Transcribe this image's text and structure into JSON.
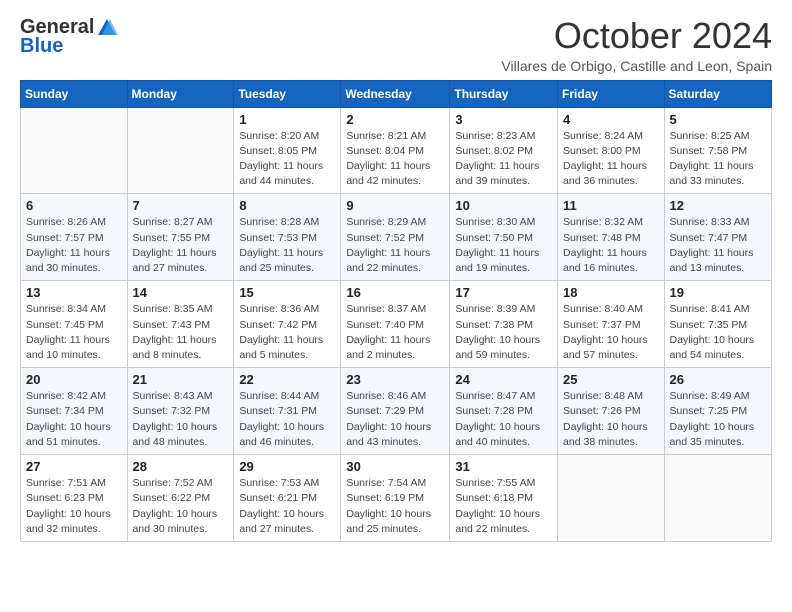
{
  "header": {
    "logo_general": "General",
    "logo_blue": "Blue",
    "month_title": "October 2024",
    "subtitle": "Villares de Orbigo, Castille and Leon, Spain"
  },
  "weekdays": [
    "Sunday",
    "Monday",
    "Tuesday",
    "Wednesday",
    "Thursday",
    "Friday",
    "Saturday"
  ],
  "weeks": [
    [
      {
        "day": "",
        "info": ""
      },
      {
        "day": "",
        "info": ""
      },
      {
        "day": "1",
        "info": "Sunrise: 8:20 AM\nSunset: 8:05 PM\nDaylight: 11 hours and 44 minutes."
      },
      {
        "day": "2",
        "info": "Sunrise: 8:21 AM\nSunset: 8:04 PM\nDaylight: 11 hours and 42 minutes."
      },
      {
        "day": "3",
        "info": "Sunrise: 8:23 AM\nSunset: 8:02 PM\nDaylight: 11 hours and 39 minutes."
      },
      {
        "day": "4",
        "info": "Sunrise: 8:24 AM\nSunset: 8:00 PM\nDaylight: 11 hours and 36 minutes."
      },
      {
        "day": "5",
        "info": "Sunrise: 8:25 AM\nSunset: 7:58 PM\nDaylight: 11 hours and 33 minutes."
      }
    ],
    [
      {
        "day": "6",
        "info": "Sunrise: 8:26 AM\nSunset: 7:57 PM\nDaylight: 11 hours and 30 minutes."
      },
      {
        "day": "7",
        "info": "Sunrise: 8:27 AM\nSunset: 7:55 PM\nDaylight: 11 hours and 27 minutes."
      },
      {
        "day": "8",
        "info": "Sunrise: 8:28 AM\nSunset: 7:53 PM\nDaylight: 11 hours and 25 minutes."
      },
      {
        "day": "9",
        "info": "Sunrise: 8:29 AM\nSunset: 7:52 PM\nDaylight: 11 hours and 22 minutes."
      },
      {
        "day": "10",
        "info": "Sunrise: 8:30 AM\nSunset: 7:50 PM\nDaylight: 11 hours and 19 minutes."
      },
      {
        "day": "11",
        "info": "Sunrise: 8:32 AM\nSunset: 7:48 PM\nDaylight: 11 hours and 16 minutes."
      },
      {
        "day": "12",
        "info": "Sunrise: 8:33 AM\nSunset: 7:47 PM\nDaylight: 11 hours and 13 minutes."
      }
    ],
    [
      {
        "day": "13",
        "info": "Sunrise: 8:34 AM\nSunset: 7:45 PM\nDaylight: 11 hours and 10 minutes."
      },
      {
        "day": "14",
        "info": "Sunrise: 8:35 AM\nSunset: 7:43 PM\nDaylight: 11 hours and 8 minutes."
      },
      {
        "day": "15",
        "info": "Sunrise: 8:36 AM\nSunset: 7:42 PM\nDaylight: 11 hours and 5 minutes."
      },
      {
        "day": "16",
        "info": "Sunrise: 8:37 AM\nSunset: 7:40 PM\nDaylight: 11 hours and 2 minutes."
      },
      {
        "day": "17",
        "info": "Sunrise: 8:39 AM\nSunset: 7:38 PM\nDaylight: 10 hours and 59 minutes."
      },
      {
        "day": "18",
        "info": "Sunrise: 8:40 AM\nSunset: 7:37 PM\nDaylight: 10 hours and 57 minutes."
      },
      {
        "day": "19",
        "info": "Sunrise: 8:41 AM\nSunset: 7:35 PM\nDaylight: 10 hours and 54 minutes."
      }
    ],
    [
      {
        "day": "20",
        "info": "Sunrise: 8:42 AM\nSunset: 7:34 PM\nDaylight: 10 hours and 51 minutes."
      },
      {
        "day": "21",
        "info": "Sunrise: 8:43 AM\nSunset: 7:32 PM\nDaylight: 10 hours and 48 minutes."
      },
      {
        "day": "22",
        "info": "Sunrise: 8:44 AM\nSunset: 7:31 PM\nDaylight: 10 hours and 46 minutes."
      },
      {
        "day": "23",
        "info": "Sunrise: 8:46 AM\nSunset: 7:29 PM\nDaylight: 10 hours and 43 minutes."
      },
      {
        "day": "24",
        "info": "Sunrise: 8:47 AM\nSunset: 7:28 PM\nDaylight: 10 hours and 40 minutes."
      },
      {
        "day": "25",
        "info": "Sunrise: 8:48 AM\nSunset: 7:26 PM\nDaylight: 10 hours and 38 minutes."
      },
      {
        "day": "26",
        "info": "Sunrise: 8:49 AM\nSunset: 7:25 PM\nDaylight: 10 hours and 35 minutes."
      }
    ],
    [
      {
        "day": "27",
        "info": "Sunrise: 7:51 AM\nSunset: 6:23 PM\nDaylight: 10 hours and 32 minutes."
      },
      {
        "day": "28",
        "info": "Sunrise: 7:52 AM\nSunset: 6:22 PM\nDaylight: 10 hours and 30 minutes."
      },
      {
        "day": "29",
        "info": "Sunrise: 7:53 AM\nSunset: 6:21 PM\nDaylight: 10 hours and 27 minutes."
      },
      {
        "day": "30",
        "info": "Sunrise: 7:54 AM\nSunset: 6:19 PM\nDaylight: 10 hours and 25 minutes."
      },
      {
        "day": "31",
        "info": "Sunrise: 7:55 AM\nSunset: 6:18 PM\nDaylight: 10 hours and 22 minutes."
      },
      {
        "day": "",
        "info": ""
      },
      {
        "day": "",
        "info": ""
      }
    ]
  ]
}
